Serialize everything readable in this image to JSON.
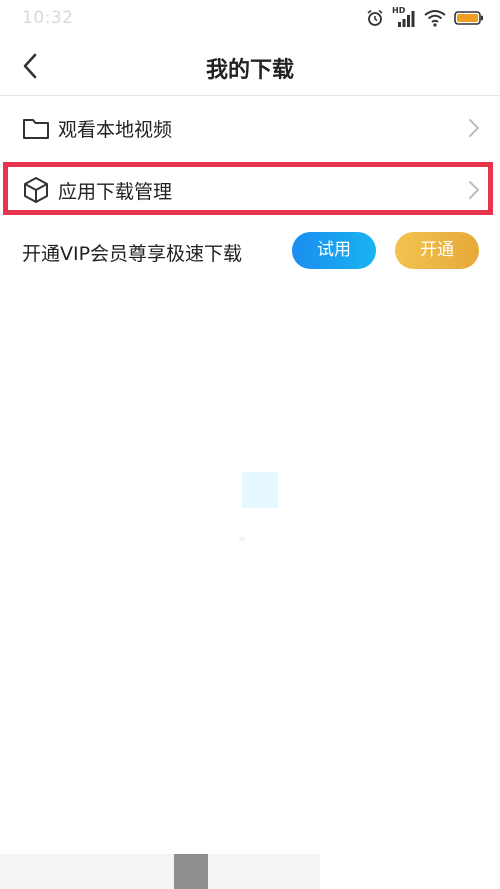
{
  "status_bar": {
    "time": "10:32",
    "icons": [
      "alarm-icon",
      "hd-signal-icon",
      "wifi-icon",
      "battery-icon"
    ],
    "network_label": "HD",
    "battery_color": "#f0a020"
  },
  "nav": {
    "title": "我的下载",
    "back_icon": "chevron-left-icon"
  },
  "menu": {
    "local_video_label": "观看本地视频",
    "app_download_label": "应用下载管理"
  },
  "vip": {
    "text": "开通VIP会员尊享极速下载",
    "trial_label": "试用",
    "open_label": "开通",
    "trial_color": "#1b8df0",
    "open_color": "#f2c34e"
  },
  "highlight": {
    "color": "#e8344a",
    "target": "app_download_label"
  }
}
